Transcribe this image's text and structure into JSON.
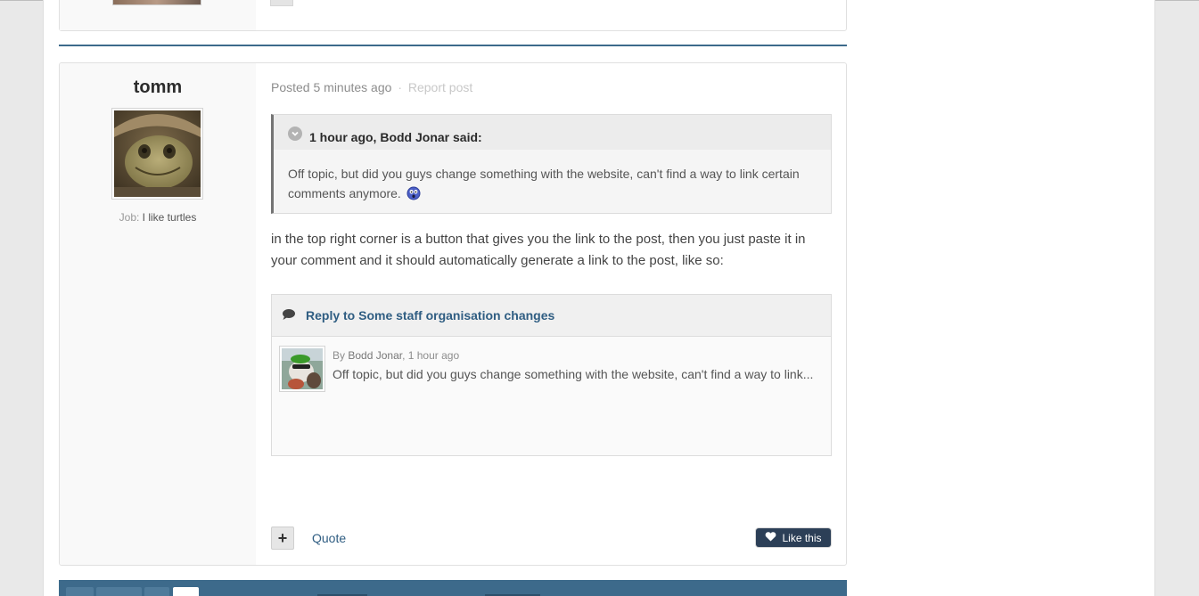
{
  "post": {
    "author": {
      "name": "tomm",
      "job_label": "Job:",
      "job_value": "I like turtles"
    },
    "meta": {
      "posted": "Posted 5 minutes ago",
      "separator": "·",
      "report": "Report post"
    },
    "quote": {
      "header": "1 hour ago, Bodd Jonar said:",
      "body": "Off topic, but did you guys change something with the website, can't find a way to link certain comments anymore.",
      "emoji_icon": "shocked-emoji-icon"
    },
    "text": "in the top right corner is a button that gives you the link to the post, then you just paste it in your comment and it should automatically generate a link to the post, like so:",
    "embed": {
      "title": "Reply to Some staff organisation changes",
      "by_prefix": "By",
      "by_name": "Bodd Jonar",
      "by_time": ", 1 hour ago",
      "excerpt": "Off topic, but did you guys change something with the website, can't find a way to link..."
    },
    "actions": {
      "plus": "+",
      "quote": "Quote",
      "like": "Like this"
    }
  },
  "colors": {
    "accent": "#3d6a8b",
    "link": "#2f5d82",
    "like_button": "#2c3f57"
  }
}
